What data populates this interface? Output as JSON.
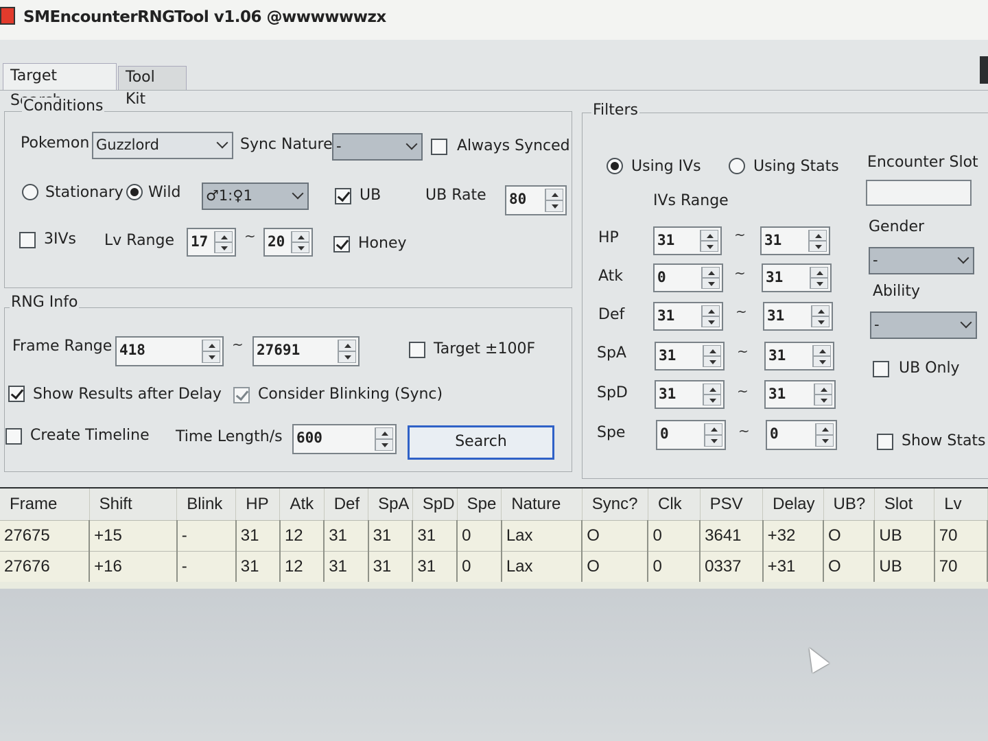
{
  "window": {
    "title": "SMEncounterRNGTool v1.06 @wwwwwwzx"
  },
  "tabs": [
    "Target Search",
    "Tool Kit"
  ],
  "conditions": {
    "legend": "Conditions",
    "pokemon_label": "Pokemon",
    "pokemon_value": "Guzzlord",
    "sync_nature_label": "Sync Nature",
    "sync_nature_value": "-",
    "always_synced_label": "Always Synced",
    "stationary_label": "Stationary",
    "wild_label": "Wild",
    "gender_ratio_value": "♂1:♀1",
    "ub_label": "UB",
    "ub_rate_label": "UB Rate",
    "ub_rate_value": "80",
    "three_ivs_label": "3IVs",
    "lv_range_label": "Lv Range",
    "lv_min": "17",
    "lv_max": "20",
    "honey_label": "Honey"
  },
  "rng_info": {
    "legend": "RNG Info",
    "frame_range_label": "Frame Range",
    "frame_min": "418",
    "frame_max": "27691",
    "target_label": "Target ±100F",
    "show_results_label": "Show Results after Delay",
    "consider_blinking_label": "Consider Blinking (Sync)",
    "create_timeline_label": "Create Timeline",
    "time_length_label": "Time Length/s",
    "time_length_value": "600",
    "search_label": "Search"
  },
  "filters": {
    "legend": "Filters",
    "using_ivs_label": "Using IVs",
    "using_stats_label": "Using Stats",
    "ivs_range_label": "IVs Range",
    "tilde": "~",
    "stats": [
      {
        "label": "HP",
        "min": "31",
        "max": "31"
      },
      {
        "label": "Atk",
        "min": "0",
        "max": "31"
      },
      {
        "label": "Def",
        "min": "31",
        "max": "31"
      },
      {
        "label": "SpA",
        "min": "31",
        "max": "31"
      },
      {
        "label": "SpD",
        "min": "31",
        "max": "31"
      },
      {
        "label": "Spe",
        "min": "0",
        "max": "0"
      }
    ],
    "encounter_slot_label": "Encounter Slot",
    "encounter_slot_value": "",
    "gender_label": "Gender",
    "gender_value": "-",
    "ability_label": "Ability",
    "ability_value": "-",
    "ub_only_label": "UB Only",
    "show_stats_label": "Show Stats"
  },
  "results": {
    "columns": [
      "Frame",
      "Shift",
      "Blink",
      "HP",
      "Atk",
      "Def",
      "SpA",
      "SpD",
      "Spe",
      "Nature",
      "Sync?",
      "Clk",
      "PSV",
      "Delay",
      "UB?",
      "Slot",
      "Lv"
    ],
    "rows": [
      [
        "27675",
        "+15",
        "-",
        "31",
        "12",
        "31",
        "31",
        "31",
        "0",
        "Lax",
        "O",
        "0",
        "3641",
        "+32",
        "O",
        "UB",
        "70"
      ],
      [
        "27676",
        "+16",
        "-",
        "31",
        "12",
        "31",
        "31",
        "31",
        "0",
        "Lax",
        "O",
        "0",
        "0337",
        "+31",
        "O",
        "UB",
        "70"
      ]
    ]
  }
}
